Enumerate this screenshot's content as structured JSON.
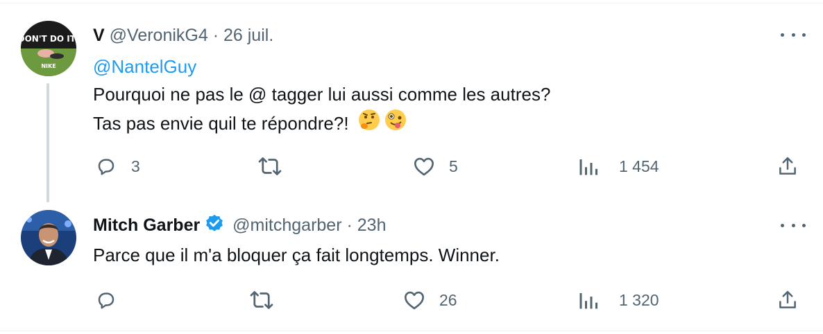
{
  "tweets": [
    {
      "display_name": "V",
      "handle": "@VeronikG4",
      "separator": "·",
      "time": "26 juil.",
      "avatar_text": "DON'T DO IT!",
      "reply_mention": "@NantelGuy",
      "text_lines": [
        "Pourquoi ne pas le @ tagger lui aussi comme les autres?",
        "Tas pas envie quil te répondre?!"
      ],
      "emojis": [
        "thinking-face-emoji",
        "zany-face-emoji"
      ],
      "replies": "3",
      "retweets": "",
      "likes": "5",
      "views": "1 454"
    },
    {
      "display_name": "Mitch Garber",
      "verified": true,
      "handle": "@mitchgarber",
      "separator": "·",
      "time": "23h",
      "text_lines": [
        "Parce que il m'a bloquer ça fait longtemps. Winner."
      ],
      "replies": "",
      "retweets": "",
      "likes": "26",
      "views": "1 320"
    }
  ],
  "icons": {
    "reply": "reply-icon",
    "retweet": "retweet-icon",
    "like": "heart-icon",
    "views": "views-icon",
    "share": "share-icon",
    "more": "more-icon",
    "verified": "verified-badge-icon"
  },
  "colors": {
    "text": "#0f1419",
    "secondary": "#536471",
    "link": "#1d9bf0",
    "verified": "#1d9bf0",
    "thread_line": "#cfd9de"
  }
}
